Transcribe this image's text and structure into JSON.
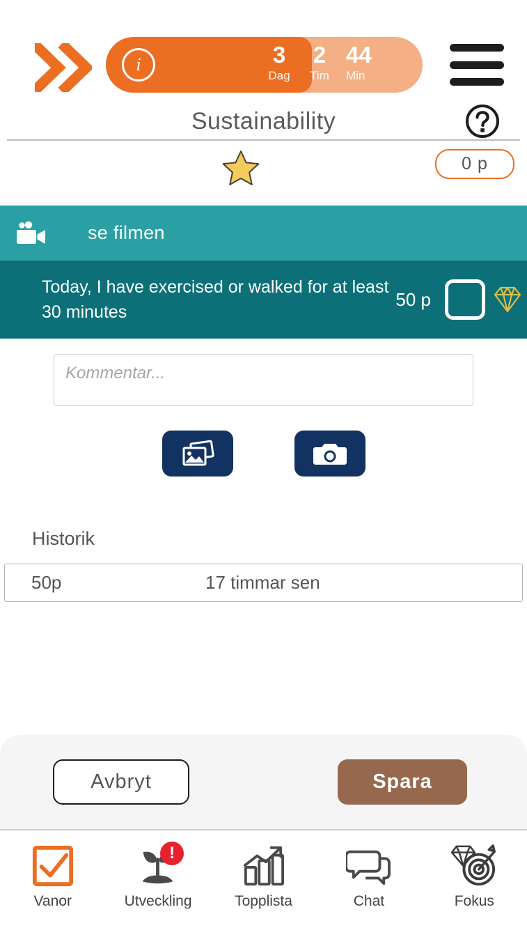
{
  "header": {
    "logo_icon": "double-chevron-right-icon",
    "menu_icon": "hamburger-menu-icon",
    "help_icon": "question-mark-circle-icon",
    "info_icon": "info-circle-icon",
    "info_glyph": "i",
    "title": "Sustainability",
    "timer": {
      "fill_percent": 65,
      "fill_color": "#ec6e22",
      "track_color": "#f4b084",
      "units": [
        {
          "value": "3",
          "label": "Dag"
        },
        {
          "value": "2",
          "label": "Tim"
        },
        {
          "value": "44",
          "label": "Min"
        }
      ]
    }
  },
  "status_row": {
    "star_icon": "star-icon",
    "star_color": "#f5cb5c",
    "points_badge": "0 p",
    "points_border_color": "#ec6e22"
  },
  "film_bar": {
    "icon": "video-camera-icon",
    "label": "se filmen",
    "background": "#2aa0a4"
  },
  "task": {
    "text": "Today, I have exercised or walked for at least 30 minutes",
    "points": "50 p",
    "checkbox_icon": "checkbox-unchecked-icon",
    "checked": false,
    "diamond_icon": "diamond-icon",
    "diamond_color": "#d9bf4a",
    "background": "#0d7078"
  },
  "comment": {
    "placeholder": "Kommentar...",
    "value": ""
  },
  "media_buttons": [
    {
      "name": "gallery-button",
      "icon": "photo-gallery-icon"
    },
    {
      "name": "camera-button",
      "icon": "camera-icon"
    }
  ],
  "history": {
    "title": "Historik",
    "rows": [
      {
        "points": "50p",
        "time": "17 timmar sen"
      }
    ]
  },
  "actions": {
    "cancel_label": "Avbryt",
    "save_label": "Spara",
    "save_color": "#96694f"
  },
  "bottom_nav": {
    "items": [
      {
        "label": "Vanor",
        "icon": "checkbox-check-icon",
        "active": true,
        "badge": null
      },
      {
        "label": "Utveckling",
        "icon": "plant-sprout-icon",
        "active": false,
        "badge": "!"
      },
      {
        "label": "Topplista",
        "icon": "bar-chart-arrow-icon",
        "active": false,
        "badge": null
      },
      {
        "label": "Chat",
        "icon": "chat-bubbles-icon",
        "active": false,
        "badge": null
      },
      {
        "label": "Fokus",
        "icon": "diamond-target-icon",
        "active": false,
        "badge": null
      }
    ]
  }
}
